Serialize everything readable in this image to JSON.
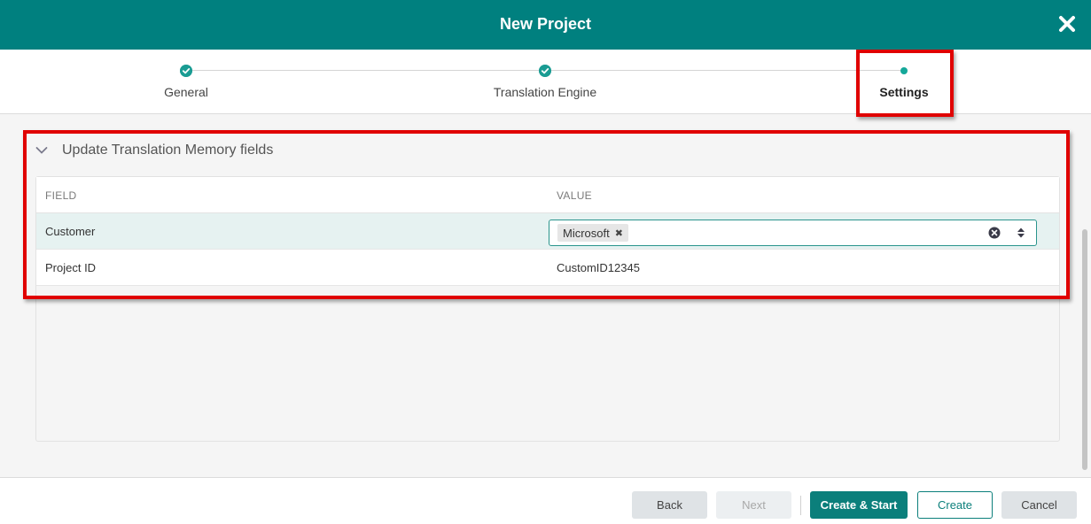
{
  "window": {
    "title": "New Project"
  },
  "steps": [
    {
      "label": "General",
      "state": "done"
    },
    {
      "label": "Translation Engine",
      "state": "done"
    },
    {
      "label": "Settings",
      "state": "current"
    }
  ],
  "section": {
    "title": "Update Translation Memory fields",
    "columns": [
      "FIELD",
      "VALUE"
    ],
    "rows": [
      {
        "field": "Customer",
        "chip": "Microsoft"
      },
      {
        "field": "Project ID",
        "value": "CustomID12345"
      }
    ]
  },
  "footer": {
    "back": "Back",
    "next": "Next",
    "create_start": "Create & Start",
    "create": "Create",
    "cancel": "Cancel"
  },
  "colors": {
    "accent": "#00807f",
    "highlight": "#e00000"
  }
}
